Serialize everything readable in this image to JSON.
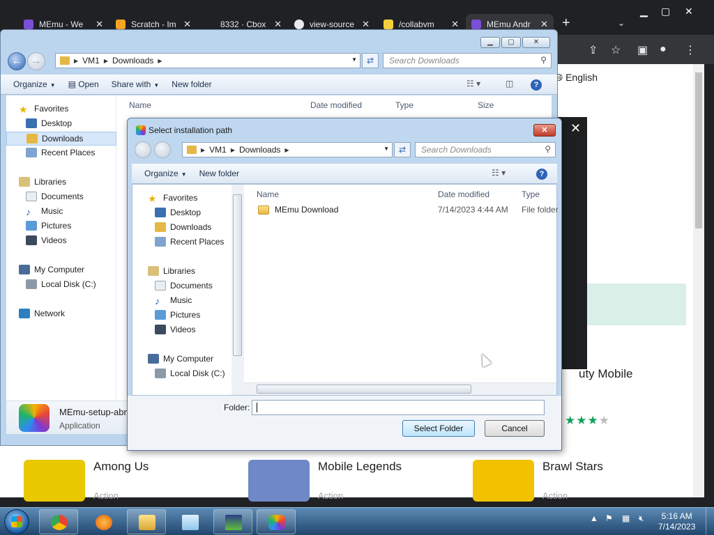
{
  "chrome": {
    "tabs": [
      {
        "title": "MEmu - We",
        "favicon_color": "#7b4fd6"
      },
      {
        "title": "Scratch - Im",
        "favicon_color": "#f6a623"
      },
      {
        "title": "8332 · Cbox",
        "favicon_color": "#202124"
      },
      {
        "title": "view-source",
        "favicon_color": "#e8eaed"
      },
      {
        "title": "/collabvm",
        "favicon_color": "#f4d03f"
      },
      {
        "title": "MEmu Andr",
        "favicon_color": "#7b4fd6"
      }
    ],
    "page": {
      "language": "English",
      "partial_title": "uty Mobile",
      "apps": [
        {
          "name": "Among Us",
          "category": "Action",
          "color": "#e8c800"
        },
        {
          "name": "Mobile Legends",
          "category": "Action",
          "color": "#6f88c8"
        },
        {
          "name": "Brawl Stars",
          "category": "Action",
          "color": "#f2c200"
        }
      ]
    }
  },
  "explorer": {
    "breadcrumb": [
      "VM1",
      "Downloads"
    ],
    "search_placeholder": "Search Downloads",
    "commands": [
      "Organize",
      "Open",
      "Share with",
      "New folder"
    ],
    "columns": [
      "Name",
      "Date modified",
      "Type",
      "Size"
    ],
    "nav": {
      "favorites": "Favorites",
      "desktop": "Desktop",
      "downloads": "Downloads",
      "recent": "Recent Places",
      "libraries": "Libraries",
      "documents": "Documents",
      "music": "Music",
      "pictures": "Pictures",
      "videos": "Videos",
      "computer": "My Computer",
      "localdisk": "Local Disk (C:)",
      "network": "Network"
    },
    "details": {
      "filename": "MEmu-setup-abr",
      "type": "Application"
    }
  },
  "dialog": {
    "title": "Select installation path",
    "breadcrumb": [
      "VM1",
      "Downloads"
    ],
    "search_placeholder": "Search Downloads",
    "commands": [
      "Organize",
      "New folder"
    ],
    "columns": [
      "Name",
      "Date modified",
      "Type"
    ],
    "nav": {
      "favorites": "Favorites",
      "desktop": "Desktop",
      "downloads": "Downloads",
      "recent": "Recent Places",
      "libraries": "Libraries",
      "documents": "Documents",
      "music": "Music",
      "pictures": "Pictures",
      "videos": "Videos",
      "computer": "My Computer",
      "localdisk": "Local Disk (C:)"
    },
    "rows": [
      {
        "name": "MEmu Download",
        "date": "7/14/2023 4:44 AM",
        "type": "File folder"
      }
    ],
    "folder_label": "Folder:",
    "folder_value": "",
    "select_button": "Select Folder",
    "cancel_button": "Cancel"
  },
  "taskbar": {
    "time": "5:16 AM",
    "date": "7/14/2023",
    "apps": [
      "chrome-icon",
      "firefox-icon",
      "explorer-icon",
      "notepad-icon",
      "installer-icon",
      "memu-icon"
    ]
  }
}
